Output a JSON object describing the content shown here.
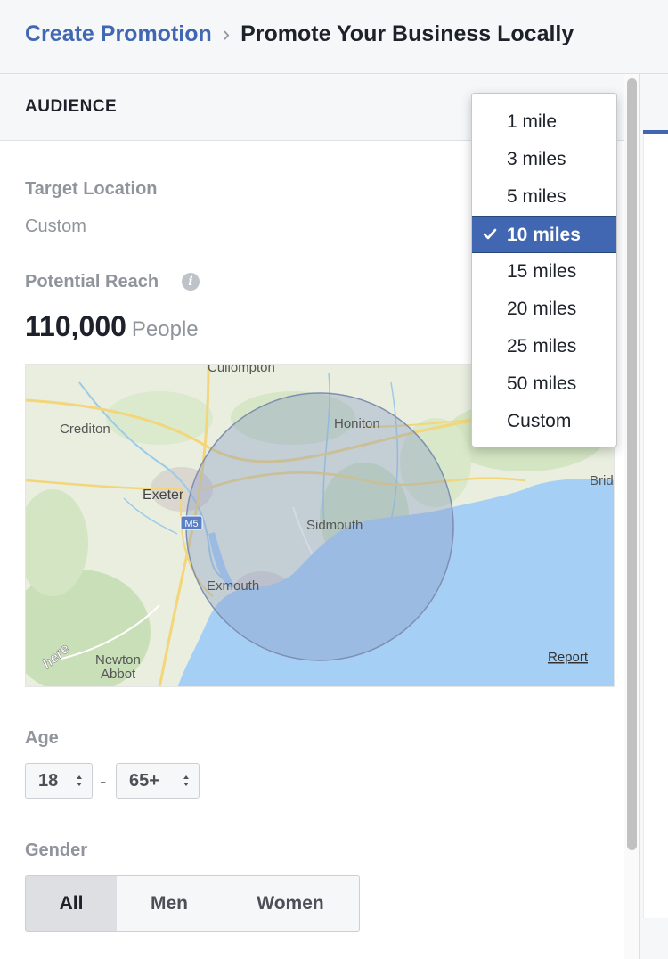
{
  "breadcrumb": {
    "link": "Create Promotion",
    "separator": "›",
    "current": "Promote Your Business Locally"
  },
  "audience": {
    "section_title": "AUDIENCE",
    "target_location_label": "Target Location",
    "target_location_value": "Custom",
    "potential_reach_label": "Potential Reach",
    "reach_number": "110,000",
    "reach_unit": "People"
  },
  "map": {
    "places": [
      "Cullompton",
      "Crediton",
      "Honiton",
      "Exeter",
      "Sidmouth",
      "Exmouth",
      "Newton",
      "Abbot",
      "Brid"
    ],
    "road_label": "M5",
    "watermark": "here",
    "report_link": "Report"
  },
  "age": {
    "label": "Age",
    "min": "18",
    "separator": "-",
    "max": "65+"
  },
  "gender": {
    "label": "Gender",
    "options": [
      "All",
      "Men",
      "Women"
    ],
    "selected": "All"
  },
  "radius_dropdown": {
    "options": [
      "1 mile",
      "3 miles",
      "5 miles",
      "10 miles",
      "15 miles",
      "20 miles",
      "25 miles",
      "50 miles",
      "Custom"
    ],
    "selected": "10 miles"
  },
  "colors": {
    "link_blue": "#4267b2",
    "water": "#a6cff5",
    "radius_fill": "#8a9bc4",
    "muted_text": "#90949c"
  }
}
